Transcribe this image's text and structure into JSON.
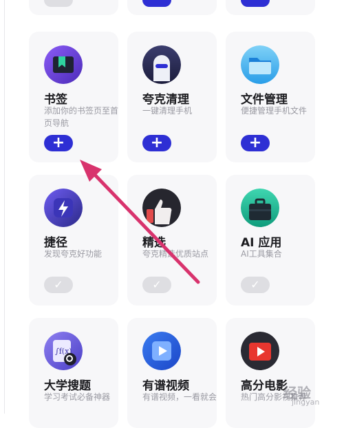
{
  "cards": [
    {
      "title": "书签",
      "desc": "添加你的书签页至首页导航",
      "icon": "bookmark-icon",
      "state": "add"
    },
    {
      "title": "夸克清理",
      "desc": "一键清理手机",
      "icon": "rocket-icon",
      "state": "add"
    },
    {
      "title": "文件管理",
      "desc": "便捷管理手机文件",
      "icon": "folder-icon",
      "state": "add"
    },
    {
      "title": "捷径",
      "desc": "发现夸克好功能",
      "icon": "shortcut-bolt-icon",
      "state": "added"
    },
    {
      "title": "精选",
      "desc": "夸克精选优质站点",
      "icon": "thumbs-up-icon",
      "state": "added"
    },
    {
      "title": "AI 应用",
      "desc": "AI工具集合",
      "icon": "toolbox-icon",
      "state": "added"
    },
    {
      "title": "大学搜题",
      "desc": "学习考试必备神器",
      "icon": "formula-search-icon",
      "state": "none"
    },
    {
      "title": "有谱视频",
      "desc": "有谱视频，一看就会",
      "icon": "video-play-icon",
      "state": "none"
    },
    {
      "title": "高分电影",
      "desc": "热门高分影视推荐",
      "icon": "movie-play-icon",
      "state": "none"
    }
  ],
  "buttons": {
    "add_label": "+",
    "added_label": "✓"
  },
  "watermark": {
    "text": "经验",
    "sub": "jingyan"
  },
  "colors": {
    "accent": "#2e2fd4",
    "arrow": "#d8336d",
    "card_bg": "#f7f7f9"
  }
}
